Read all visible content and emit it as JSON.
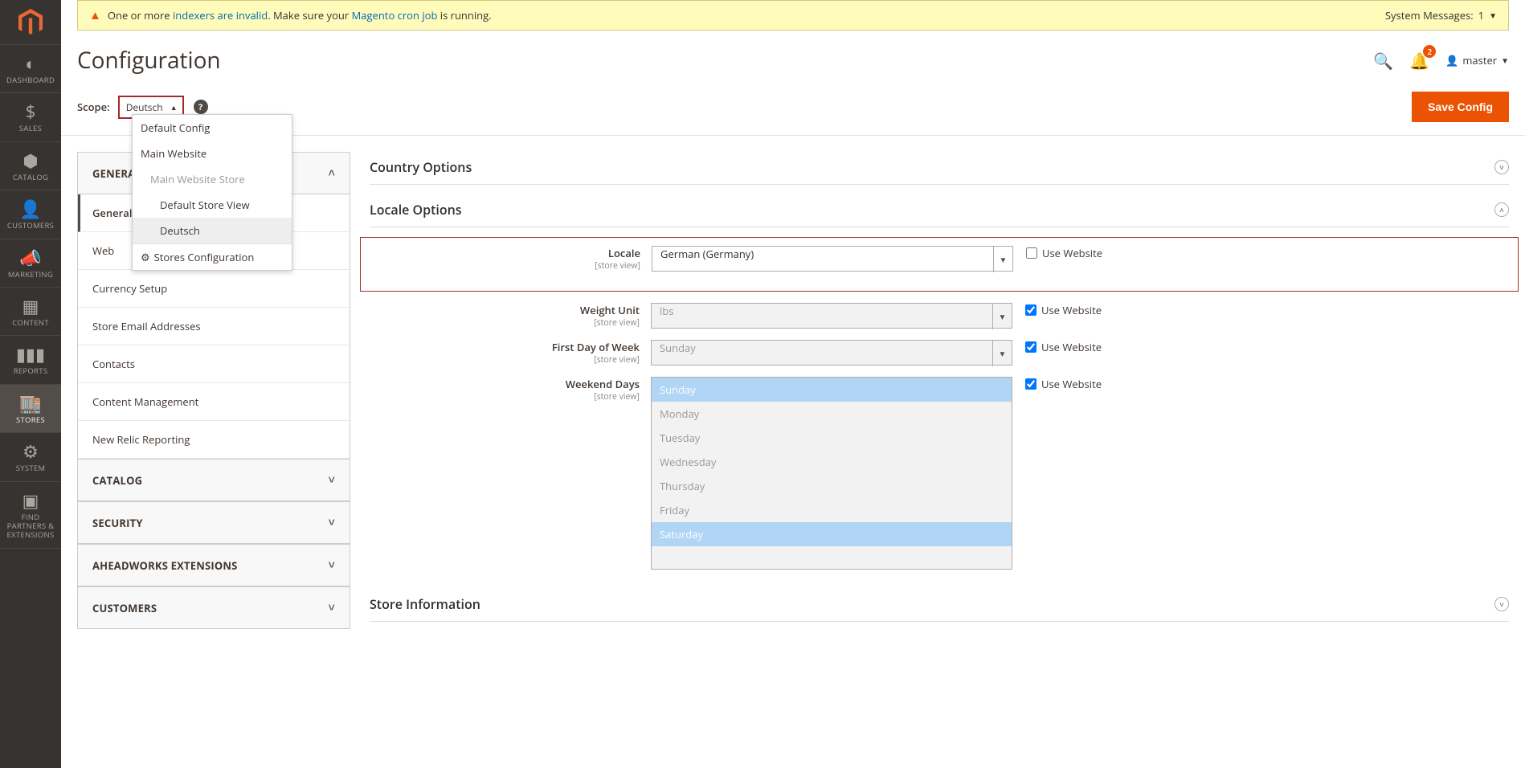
{
  "sysmsg": {
    "text_pre": "One or more ",
    "link1": "indexers are invalid",
    "text_mid": ". Make sure your ",
    "link2": "Magento cron job",
    "text_post": " is running.",
    "right_label": "System Messages:",
    "right_count": "1"
  },
  "page": {
    "title": "Configuration"
  },
  "header": {
    "notif_count": "2",
    "user": "master"
  },
  "nav": {
    "dashboard": "DASHBOARD",
    "sales": "SALES",
    "catalog": "CATALOG",
    "customers": "CUSTOMERS",
    "marketing": "MARKETING",
    "content": "CONTENT",
    "reports": "REPORTS",
    "stores": "STORES",
    "system": "SYSTEM",
    "partners": "FIND PARTNERS & EXTENSIONS"
  },
  "scope": {
    "label": "Scope:",
    "selected": "Deutsch",
    "dropdown": {
      "default_config": "Default Config",
      "main_website": "Main Website",
      "main_website_store": "Main Website Store",
      "default_store_view": "Default Store View",
      "deutsch": "Deutsch",
      "stores_config": "Stores Configuration"
    },
    "save_btn": "Save Config"
  },
  "cfg_nav": {
    "general": {
      "head": "GENERAL",
      "items": [
        "General",
        "Web",
        "Currency Setup",
        "Store Email Addresses",
        "Contacts",
        "Content Management",
        "New Relic Reporting"
      ]
    },
    "catalog": "CATALOG",
    "security": "SECURITY",
    "aheadworks": "AHEADWORKS EXTENSIONS",
    "customers": "CUSTOMERS"
  },
  "sections": {
    "country": "Country Options",
    "locale": "Locale Options",
    "store_info": "Store Information"
  },
  "fields": {
    "locale": {
      "label": "Locale",
      "scope": "[store view]",
      "value": "German (Germany)",
      "use": "Use Website"
    },
    "weight": {
      "label": "Weight Unit",
      "scope": "[store view]",
      "value": "lbs",
      "use": "Use Website"
    },
    "firstday": {
      "label": "First Day of Week",
      "scope": "[store view]",
      "value": "Sunday",
      "use": "Use Website"
    },
    "weekend": {
      "label": "Weekend Days",
      "scope": "[store view]",
      "use": "Use Website",
      "options": [
        "Sunday",
        "Monday",
        "Tuesday",
        "Wednesday",
        "Thursday",
        "Friday",
        "Saturday"
      ],
      "selected": [
        0,
        6
      ]
    }
  }
}
